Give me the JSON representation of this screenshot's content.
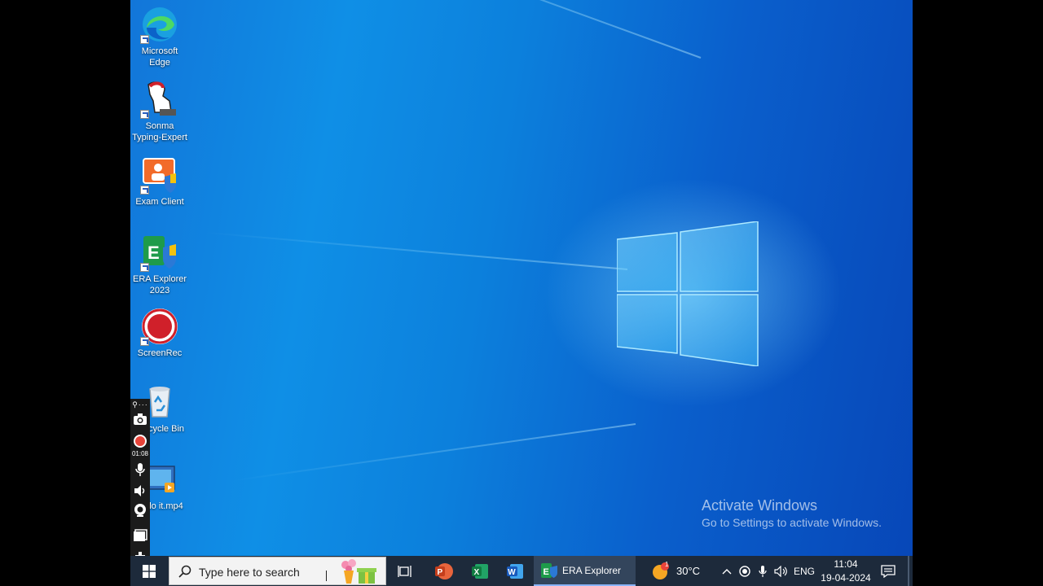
{
  "desktop": {
    "icons": [
      {
        "label": "Microsoft Edge",
        "icon": "edge-icon"
      },
      {
        "label": "Sonma Typing-Expert",
        "icon": "typing-expert-icon"
      },
      {
        "label": "Exam Client",
        "icon": "exam-client-icon"
      },
      {
        "label": "ERA Explorer 2023",
        "icon": "era-explorer-icon"
      },
      {
        "label": "ScreenRec",
        "icon": "screenrec-icon"
      },
      {
        "label": "cycle Bin",
        "icon": "recycle-bin-icon"
      },
      {
        "label": "lo it.mp4",
        "icon": "video-file-icon"
      }
    ],
    "watermark": {
      "title": "Activate Windows",
      "subtitle": "Go to Settings to activate Windows."
    }
  },
  "recorder_toolbar": {
    "timer": "01:08",
    "icons": [
      "camera-icon",
      "record-icon",
      "microphone-icon",
      "speaker-icon",
      "webcam-icon",
      "window-icon"
    ]
  },
  "taskbar": {
    "search_placeholder": "Type here to search",
    "apps": [
      {
        "icon": "task-view-icon"
      },
      {
        "icon": "powerpoint-icon"
      },
      {
        "icon": "excel-icon"
      },
      {
        "icon": "word-icon"
      },
      {
        "icon": "era-explorer-icon",
        "label": "ERA Explorer"
      }
    ],
    "weather": {
      "temp": "30°C",
      "badge": "1"
    },
    "tray": {
      "language": "ENG",
      "time": "11:04",
      "date": "19-04-2024"
    }
  },
  "colors": {
    "taskbar": "#1d2a3b",
    "wallpaper_blue": "#0c80dc"
  }
}
